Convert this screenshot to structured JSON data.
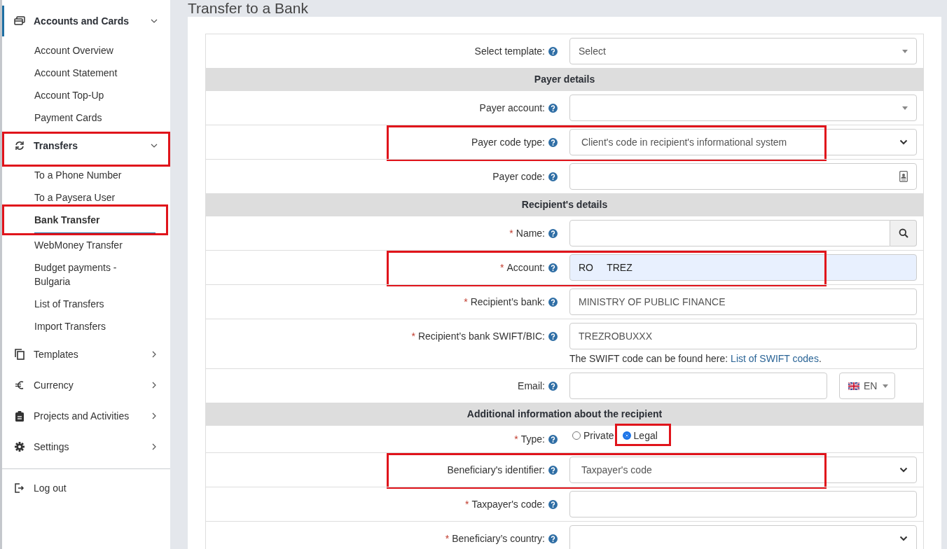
{
  "page": {
    "title": "Transfer to a Bank"
  },
  "sidebar": {
    "groups": [
      {
        "label": "Accounts and Cards",
        "active": true,
        "expanded": true,
        "highlighted": false,
        "children": [
          {
            "label": "Account Overview",
            "selected": false,
            "highlighted": false
          },
          {
            "label": "Account Statement",
            "selected": false,
            "highlighted": false
          },
          {
            "label": "Account Top-Up",
            "selected": false,
            "highlighted": false
          },
          {
            "label": "Payment Cards",
            "selected": false,
            "highlighted": false
          }
        ]
      },
      {
        "label": "Transfers",
        "active": false,
        "expanded": true,
        "highlighted": true,
        "children": [
          {
            "label": "To a Phone Number",
            "selected": false,
            "highlighted": false
          },
          {
            "label": "To a Paysera User",
            "selected": false,
            "highlighted": false
          },
          {
            "label": "Bank Transfer",
            "selected": true,
            "highlighted": true
          },
          {
            "label": "WebMoney Transfer",
            "selected": false,
            "highlighted": false
          },
          {
            "label": "Budget payments - Bulgaria",
            "selected": false,
            "highlighted": false
          },
          {
            "label": "List of Transfers",
            "selected": false,
            "highlighted": false
          },
          {
            "label": "Import Transfers",
            "selected": false,
            "highlighted": false
          }
        ]
      },
      {
        "label": "Templates",
        "active": false,
        "expanded": false,
        "highlighted": false
      },
      {
        "label": "Currency",
        "active": false,
        "expanded": false,
        "highlighted": false
      },
      {
        "label": "Projects and Activities",
        "active": false,
        "expanded": false,
        "highlighted": false
      },
      {
        "label": "Settings",
        "active": false,
        "expanded": false,
        "highlighted": false
      }
    ],
    "footer": [
      {
        "label": "Log out"
      }
    ]
  },
  "form": {
    "rows": [
      {
        "kind": "field",
        "label": "Select template:",
        "highlighted": false,
        "control": {
          "kind": "combo",
          "value": "Select"
        }
      },
      {
        "kind": "section",
        "label": "Payer details"
      },
      {
        "kind": "field",
        "label": "Payer account:",
        "highlighted": false,
        "control": {
          "kind": "combo"
        }
      },
      {
        "kind": "field",
        "label": "Payer code type:",
        "highlighted": true,
        "control": {
          "kind": "select",
          "value": "Client's code in recipient's informational system"
        }
      },
      {
        "kind": "field",
        "label": "Payer code:",
        "highlighted": false,
        "control": {
          "kind": "contact-input"
        }
      },
      {
        "kind": "section",
        "label": "Recipient's details"
      },
      {
        "kind": "field",
        "required_mark": "*",
        "label": "Name:",
        "highlighted": false,
        "control": {
          "kind": "search-input"
        }
      },
      {
        "kind": "field",
        "required_mark": "*",
        "label": "Account:",
        "highlighted": true,
        "control": {
          "kind": "input",
          "value": "RO     TREZ",
          "autofilled": true
        }
      },
      {
        "kind": "field",
        "required_mark": "*",
        "label": "Recipient’s bank:",
        "highlighted": false,
        "control": {
          "kind": "input",
          "value": "MINISTRY OF PUBLIC FINANCE",
          "autofilled": false
        }
      },
      {
        "kind": "field",
        "required_mark": "*",
        "label": "Recipient’s bank SWIFT/BIC:",
        "highlighted": false,
        "control": {
          "kind": "input",
          "value": "TREZROBUXXX",
          "autofilled": false,
          "help_text": {
            "before": "The SWIFT code can be found here: ",
            "link": "List of SWIFT codes",
            "after": "."
          }
        }
      },
      {
        "kind": "field",
        "label": "Email:",
        "highlighted": false,
        "control": {
          "kind": "email-lang",
          "language": "EN"
        }
      },
      {
        "kind": "section",
        "label": "Additional information about the recipient"
      },
      {
        "kind": "field",
        "required_mark": "*",
        "label": "Type:",
        "highlighted": false,
        "control": {
          "kind": "radio",
          "options": [
            {
              "label": "Private",
              "selected": false,
              "highlighted": false
            },
            {
              "label": "Legal",
              "selected": true,
              "highlighted": true
            }
          ]
        }
      },
      {
        "kind": "field",
        "label": "Beneficiary's identifier:",
        "highlighted": true,
        "control": {
          "kind": "select",
          "value": "Taxpayer's code"
        }
      },
      {
        "kind": "field",
        "required_mark": "*",
        "label": "Taxpayer's code:",
        "highlighted": false,
        "control": {
          "kind": "input",
          "autofilled": false
        }
      },
      {
        "kind": "field",
        "required_mark": "*",
        "label": "Beneficiary’s country:",
        "highlighted": false,
        "control": {
          "kind": "select"
        }
      }
    ]
  }
}
